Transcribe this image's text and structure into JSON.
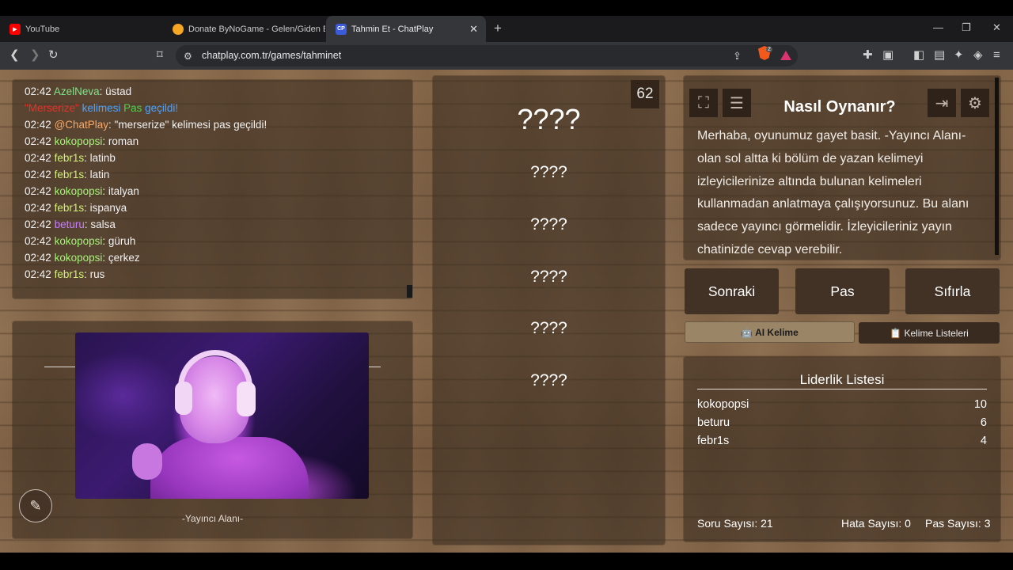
{
  "browser": {
    "tabs": [
      {
        "label": "YouTube",
        "favicon": "youtube-icon",
        "color": "#ff0000"
      },
      {
        "label": "Donate ByNoGame - Gelen/Giden Ba",
        "favicon": "bynogame-icon",
        "color": "#f5a623"
      },
      {
        "label": "Tahmin Et - ChatPlay",
        "favicon": "chatplay-icon",
        "color": "#3b5bdb",
        "favicon_text": "CP",
        "active": true
      }
    ],
    "url": "chatplay.com.tr/games/tahminet",
    "brave_badge": "2"
  },
  "chat": {
    "messages": [
      {
        "time": "02:42",
        "user": "AzelNeva",
        "user_color": "#7fe28a",
        "text": ": üstad"
      },
      {
        "system_parts": [
          {
            "text": "\"Merserize\"",
            "color": "#e2332b"
          },
          {
            "text": " kelimesi ",
            "color": "#4aa3ff"
          },
          {
            "text": "Pas",
            "color": "#4fd14f"
          },
          {
            "text": " geçildi!",
            "color": "#4aa3ff"
          }
        ]
      },
      {
        "time": "02:42",
        "user": "@ChatPlay",
        "user_color": "#f6a96b",
        "text": ": \"merserize\" kelimesi pas geçildi!"
      },
      {
        "time": "02:42",
        "user": "kokopopsi",
        "user_color": "#a6f07a",
        "text": ": roman"
      },
      {
        "time": "02:42",
        "user": "febr1s",
        "user_color": "#d2f07a",
        "text": ": latinb"
      },
      {
        "time": "02:42",
        "user": "febr1s",
        "user_color": "#d2f07a",
        "text": ": latin"
      },
      {
        "time": "02:42",
        "user": "kokopopsi",
        "user_color": "#a6f07a",
        "text": ": italyan"
      },
      {
        "time": "02:42",
        "user": "febr1s",
        "user_color": "#d2f07a",
        "text": ": ispanya"
      },
      {
        "time": "02:42",
        "user": "beturu",
        "user_color": "#c77dff",
        "text": ": salsa"
      },
      {
        "time": "02:42",
        "user": "kokopopsi",
        "user_color": "#a6f07a",
        "text": ": güruh"
      },
      {
        "time": "02:42",
        "user": "kokopopsi",
        "user_color": "#a6f07a",
        "text": ": çerkez"
      },
      {
        "time": "02:42",
        "user": "febr1s",
        "user_color": "#d2f07a",
        "text": ": rus"
      }
    ]
  },
  "streamer": {
    "label": "-Yayıncı Alanı-",
    "edit_icon": "pencil-icon"
  },
  "game": {
    "timer": "62",
    "main_word": "????",
    "forbidden_words": [
      "????",
      "????",
      "????",
      "????",
      "????"
    ]
  },
  "how_to_play": {
    "title": "Nasıl Oynanır?",
    "text": "Merhaba, oyunumuz gayet basit. -Yayıncı Alanı- olan sol altta ki bölüm de yazan kelimeyi izleyicilerinize altında bulunan kelimeleri kullanmadan anlatmaya çalışıyorsunuz. Bu alanı sadece yayıncı görmelidir. İzleyicileriniz yayın chatinizde cevap verebilir.",
    "icons": [
      "fullscreen-icon",
      "notes-icon",
      "exit-icon",
      "settings-icon"
    ]
  },
  "controls": {
    "next": "Sonraki",
    "pass": "Pas",
    "reset": "Sıfırla",
    "ai_word": "🤖 AI Kelime",
    "word_lists": "📋 Kelime Listeleri"
  },
  "leaderboard": {
    "title": "Liderlik Listesi",
    "rows": [
      {
        "name": "kokopopsi",
        "score": "10"
      },
      {
        "name": "beturu",
        "score": "6"
      },
      {
        "name": "febr1s",
        "score": "4"
      }
    ],
    "question_count": "Soru Sayısı: 21",
    "error_count": "Hata Sayısı: 0",
    "pass_count": "Pas Sayısı: 3"
  }
}
